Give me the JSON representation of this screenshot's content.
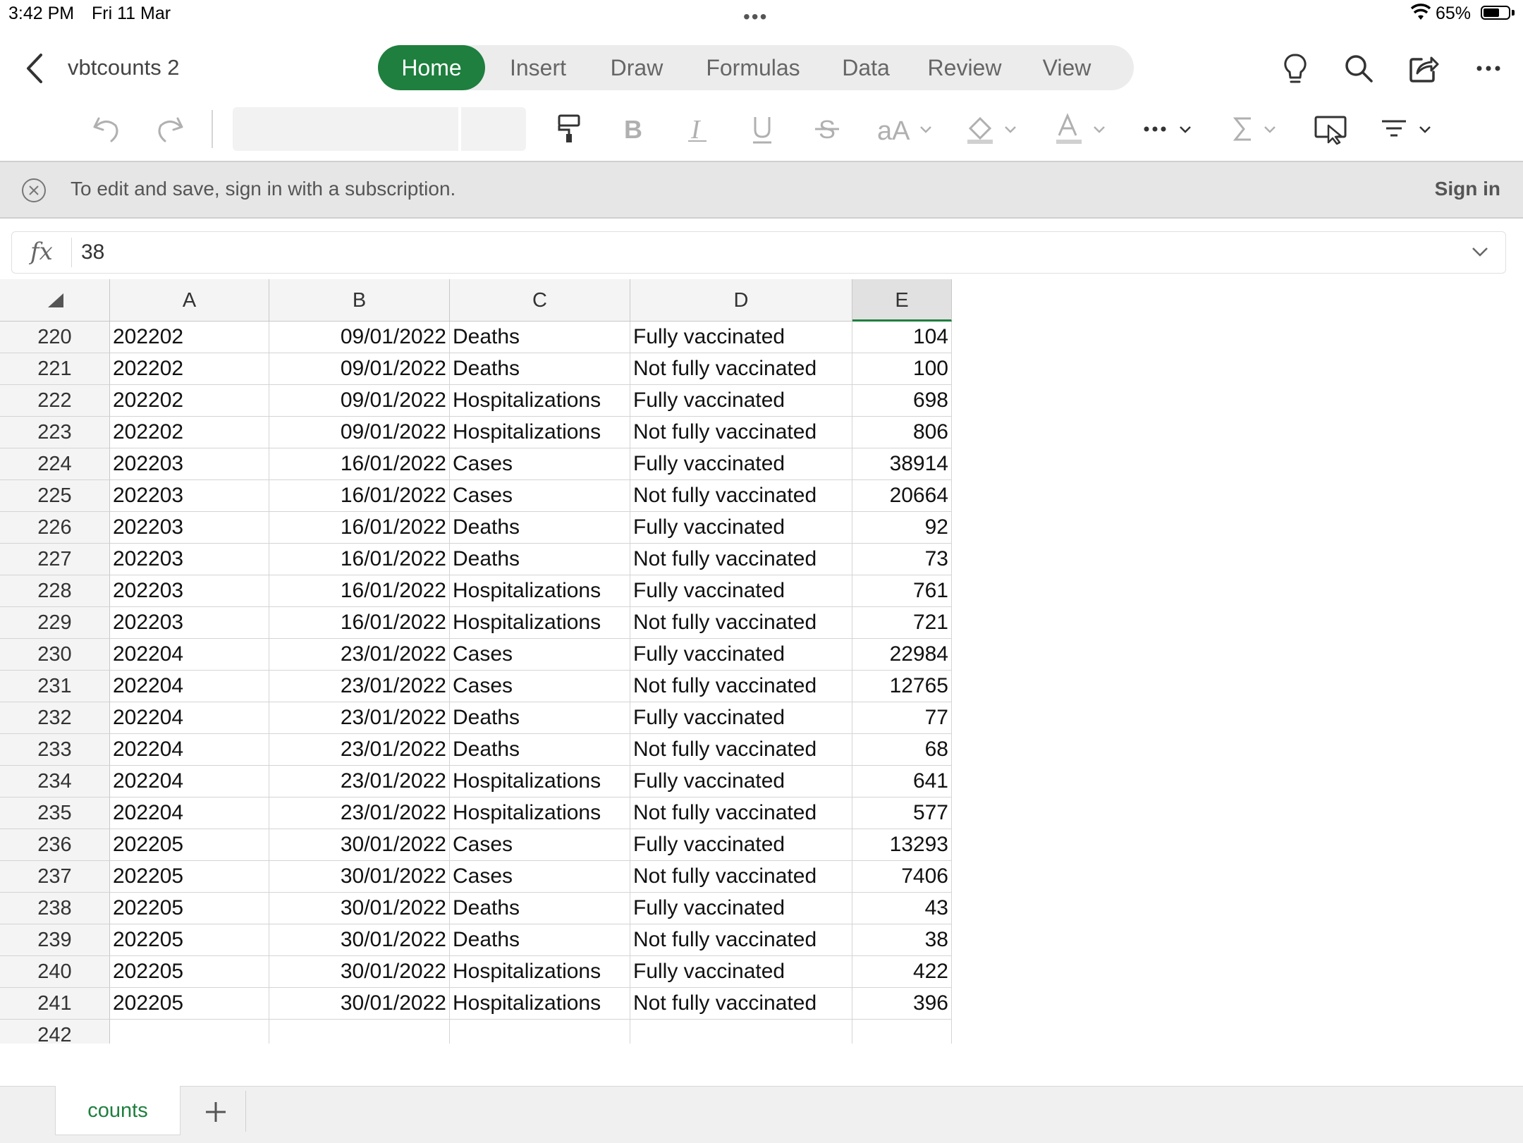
{
  "status": {
    "time": "3:42 PM",
    "date": "Fri 11 Mar",
    "battery": "65%",
    "battery_level": 0.65
  },
  "doc": {
    "title": "vbtcounts 2"
  },
  "tabs": [
    "Home",
    "Insert",
    "Draw",
    "Formulas",
    "Data",
    "Review",
    "View"
  ],
  "active_tab": "Home",
  "toolbar": {
    "icons": [
      "undo-icon",
      "redo-icon",
      "format-painter-icon",
      "bold-icon",
      "italic-icon",
      "underline-icon",
      "strikethrough-icon",
      "font-size-icon",
      "fill-color-icon",
      "font-color-icon",
      "more-icon",
      "autosum-icon",
      "touch-mode-icon",
      "filter-icon"
    ],
    "right_icons": [
      "lightbulb-icon",
      "search-icon",
      "share-icon",
      "more-icon"
    ],
    "font_aA": "aA"
  },
  "banner": {
    "message": "To edit and save, sign in with a subscription.",
    "signin": "Sign in"
  },
  "formula": {
    "fx": "fx",
    "value": "38"
  },
  "columns": [
    "A",
    "B",
    "C",
    "D",
    "E"
  ],
  "selected_column": "E",
  "rows": [
    {
      "n": "220",
      "a": "202202",
      "b": "09/01/2022",
      "c": "Deaths",
      "d": "Fully vaccinated",
      "e": "104"
    },
    {
      "n": "221",
      "a": "202202",
      "b": "09/01/2022",
      "c": "Deaths",
      "d": "Not fully vaccinated",
      "e": "100"
    },
    {
      "n": "222",
      "a": "202202",
      "b": "09/01/2022",
      "c": "Hospitalizations",
      "d": "Fully vaccinated",
      "e": "698"
    },
    {
      "n": "223",
      "a": "202202",
      "b": "09/01/2022",
      "c": "Hospitalizations",
      "d": "Not fully vaccinated",
      "e": "806"
    },
    {
      "n": "224",
      "a": "202203",
      "b": "16/01/2022",
      "c": "Cases",
      "d": "Fully vaccinated",
      "e": "38914"
    },
    {
      "n": "225",
      "a": "202203",
      "b": "16/01/2022",
      "c": "Cases",
      "d": "Not fully vaccinated",
      "e": "20664"
    },
    {
      "n": "226",
      "a": "202203",
      "b": "16/01/2022",
      "c": "Deaths",
      "d": "Fully vaccinated",
      "e": "92"
    },
    {
      "n": "227",
      "a": "202203",
      "b": "16/01/2022",
      "c": "Deaths",
      "d": "Not fully vaccinated",
      "e": "73"
    },
    {
      "n": "228",
      "a": "202203",
      "b": "16/01/2022",
      "c": "Hospitalizations",
      "d": "Fully vaccinated",
      "e": "761"
    },
    {
      "n": "229",
      "a": "202203",
      "b": "16/01/2022",
      "c": "Hospitalizations",
      "d": "Not fully vaccinated",
      "e": "721"
    },
    {
      "n": "230",
      "a": "202204",
      "b": "23/01/2022",
      "c": "Cases",
      "d": "Fully vaccinated",
      "e": "22984"
    },
    {
      "n": "231",
      "a": "202204",
      "b": "23/01/2022",
      "c": "Cases",
      "d": "Not fully vaccinated",
      "e": "12765"
    },
    {
      "n": "232",
      "a": "202204",
      "b": "23/01/2022",
      "c": "Deaths",
      "d": "Fully vaccinated",
      "e": "77"
    },
    {
      "n": "233",
      "a": "202204",
      "b": "23/01/2022",
      "c": "Deaths",
      "d": "Not fully vaccinated",
      "e": "68"
    },
    {
      "n": "234",
      "a": "202204",
      "b": "23/01/2022",
      "c": "Hospitalizations",
      "d": "Fully vaccinated",
      "e": "641"
    },
    {
      "n": "235",
      "a": "202204",
      "b": "23/01/2022",
      "c": "Hospitalizations",
      "d": "Not fully vaccinated",
      "e": "577"
    },
    {
      "n": "236",
      "a": "202205",
      "b": "30/01/2022",
      "c": "Cases",
      "d": "Fully vaccinated",
      "e": "13293"
    },
    {
      "n": "237",
      "a": "202205",
      "b": "30/01/2022",
      "c": "Cases",
      "d": "Not fully vaccinated",
      "e": "7406"
    },
    {
      "n": "238",
      "a": "202205",
      "b": "30/01/2022",
      "c": "Deaths",
      "d": "Fully vaccinated",
      "e": "43"
    },
    {
      "n": "239",
      "a": "202205",
      "b": "30/01/2022",
      "c": "Deaths",
      "d": "Not fully vaccinated",
      "e": "38"
    },
    {
      "n": "240",
      "a": "202205",
      "b": "30/01/2022",
      "c": "Hospitalizations",
      "d": "Fully vaccinated",
      "e": "422"
    },
    {
      "n": "241",
      "a": "202205",
      "b": "30/01/2022",
      "c": "Hospitalizations",
      "d": "Not fully vaccinated",
      "e": "396"
    },
    {
      "n": "242",
      "a": "",
      "b": "",
      "c": "",
      "d": "",
      "e": ""
    }
  ],
  "sheets": [
    "counts"
  ],
  "colors": {
    "accent": "#1e7f3e",
    "header_bg": "#f4f4f4",
    "banner_bg": "#e6e6e6"
  }
}
